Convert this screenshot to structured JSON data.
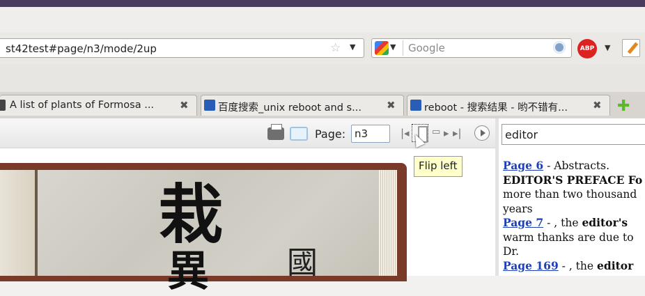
{
  "browser": {
    "url": "st42test#page/n3/mode/2up",
    "search_placeholder": "Google",
    "abp_label": "ABP"
  },
  "tabs": [
    {
      "title": "A list of plants of Formosa ...",
      "close": "✖"
    },
    {
      "title": "百度搜索_unix reboot and s...",
      "close": "✖"
    },
    {
      "title": "reboot - 搜索结果 - 哟不错有...",
      "close": "✖"
    }
  ],
  "viewer": {
    "page_label": "Page:",
    "page_value": "n3",
    "tooltip": "Flip left",
    "nav": {
      "first": "|◂",
      "next": "▸",
      "last": "▸|"
    }
  },
  "book": {
    "chars": [
      "栽",
      "異",
      "國"
    ]
  },
  "sidebar": {
    "search_value": "editor",
    "results": [
      {
        "link": "Page 6",
        "lines": [
          " - Abstracts.",
          "EDITOR'S PREFACE Fo",
          "more than two thousand",
          "years"
        ]
      },
      {
        "link": "Page 7",
        "lines": [
          " - , the ",
          "editor's",
          "warm thanks are due to",
          "Dr."
        ]
      },
      {
        "link": "Page 169",
        "lines": [
          " - , the ",
          "editor"
        ]
      }
    ]
  }
}
